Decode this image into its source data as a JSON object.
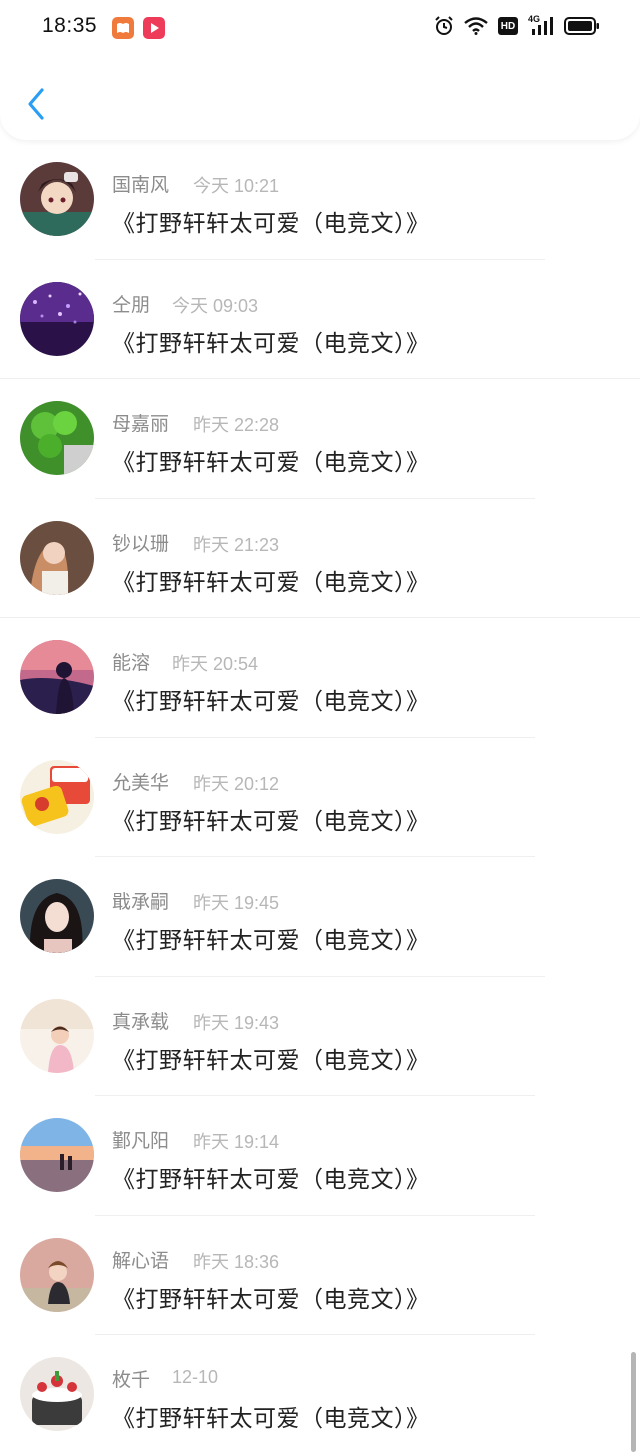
{
  "status_bar": {
    "time": "18:35",
    "app_icons": [
      {
        "name": "reader-app-icon",
        "color": "#f07a3c"
      },
      {
        "name": "video-app-icon",
        "color": "#ef3b5a"
      }
    ],
    "right_icons": [
      "alarm-icon",
      "wifi-icon",
      "hd-icon",
      "signal-4g-icon",
      "battery-icon"
    ],
    "hd_label": "HD",
    "network_label": "4G"
  },
  "header": {
    "back_icon": "chevron-left-icon",
    "accent": "#2a9df4"
  },
  "messages": [
    {
      "name": "国南风",
      "time": "今天 10:21",
      "text": "《打野轩轩太可爱（电竞文）》",
      "avatar": "anime-character-avatar"
    },
    {
      "name": "仝朋",
      "time": "今天 09:03",
      "text": "《打野轩轩太可爱（电竞文）》",
      "avatar": "purple-glitter-avatar"
    },
    {
      "name": "母嘉丽",
      "time": "昨天 22:28",
      "text": "《打野轩轩太可爱（电竞文）》",
      "avatar": "clover-avatar"
    },
    {
      "name": "钞以珊",
      "time": "昨天 21:23",
      "text": "《打野轩轩太可爱（电竞文）》",
      "avatar": "girl-portrait-avatar"
    },
    {
      "name": "能溶",
      "time": "昨天 20:54",
      "text": "《打野轩轩太可爱（电竞文）》",
      "avatar": "silhouette-avatar"
    },
    {
      "name": "允美华",
      "time": "昨天 20:12",
      "text": "《打野轩轩太可爱（电竞文）》",
      "avatar": "cartoon-food-avatar"
    },
    {
      "name": "戢承嗣",
      "time": "昨天 19:45",
      "text": "《打野轩轩太可爱（电竞文）》",
      "avatar": "woman-portrait-avatar"
    },
    {
      "name": "真承载",
      "time": "昨天 19:43",
      "text": "《打野轩轩太可爱（电竞文）》",
      "avatar": "child-avatar"
    },
    {
      "name": "鄞凡阳",
      "time": "昨天 19:14",
      "text": "《打野轩轩太可爱（电竞文）》",
      "avatar": "beach-sunset-avatar"
    },
    {
      "name": "解心语",
      "time": "昨天 18:36",
      "text": "《打野轩轩太可爱（电竞文）》",
      "avatar": "kid-outdoor-avatar"
    },
    {
      "name": "枚千",
      "time": "12-10",
      "text": "《打野轩轩太可爱（电竞文）》",
      "avatar": "cake-avatar"
    }
  ],
  "colors": {
    "name": "#8c8c8c",
    "timestamp": "#b7b7b7",
    "message": "#222222",
    "divider": "#efefef"
  }
}
